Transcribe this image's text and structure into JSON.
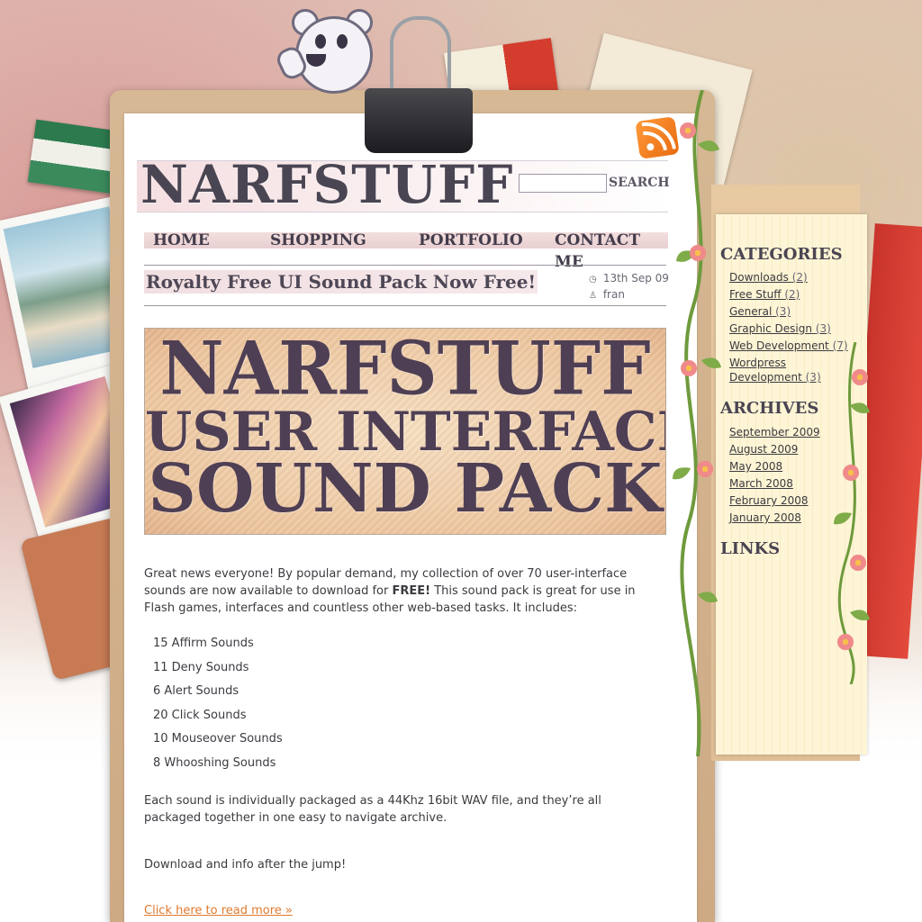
{
  "site": {
    "logo": "NARFSTUFF",
    "search_button": "SEARCH",
    "search_value": ""
  },
  "nav": {
    "items": [
      "HOME",
      "SHOPPING",
      "PORTFOLIO",
      "CONTACT ME"
    ]
  },
  "post": {
    "title": "Royalty Free UI Sound Pack Now Free!",
    "date": "13th Sep 09",
    "author": "fran",
    "banner_lines": [
      "NARFSTUFF",
      "USER INTERFACE",
      "SOUND PACK"
    ],
    "intro_part1": "Great news everyone! By popular demand, my collection of over 70 user-interface sounds are now available to download for ",
    "intro_bold": "FREE!",
    "intro_part2": " This sound pack is great for use in Flash games, interfaces and countless other web-based tasks. It includes:",
    "list": [
      "15 Affirm Sounds",
      "11 Deny Sounds",
      "6 Alert Sounds",
      "20 Click Sounds",
      "10 Mouseover Sounds",
      "8 Whooshing Sounds"
    ],
    "paragraph2": "Each sound is individually packaged as a 44Khz 16bit WAV file, and they’re all packaged together in one easy to navigate archive.",
    "paragraph3": "Download and info after the jump!",
    "read_more": "Click here to read more »"
  },
  "sidebar": {
    "categories_title": "CATEGORIES",
    "categories": [
      {
        "label": "Downloads",
        "count": "(2)"
      },
      {
        "label": "Free Stuff",
        "count": "(2)"
      },
      {
        "label": "General",
        "count": "(3)"
      },
      {
        "label": "Graphic Design",
        "count": "(3)"
      },
      {
        "label": "Web Development",
        "count": "(7)"
      },
      {
        "label": "Wordpress Development",
        "count": "(3)"
      }
    ],
    "archives_title": "ARCHIVES",
    "archives": [
      "September 2009",
      "August 2009",
      "May 2008",
      "March 2008",
      "February 2008",
      "January 2008"
    ],
    "links_title": "LINKS"
  },
  "colors": {
    "accent_link": "#e07a2e",
    "heading": "#4a4552",
    "rss": "#f08a24"
  }
}
